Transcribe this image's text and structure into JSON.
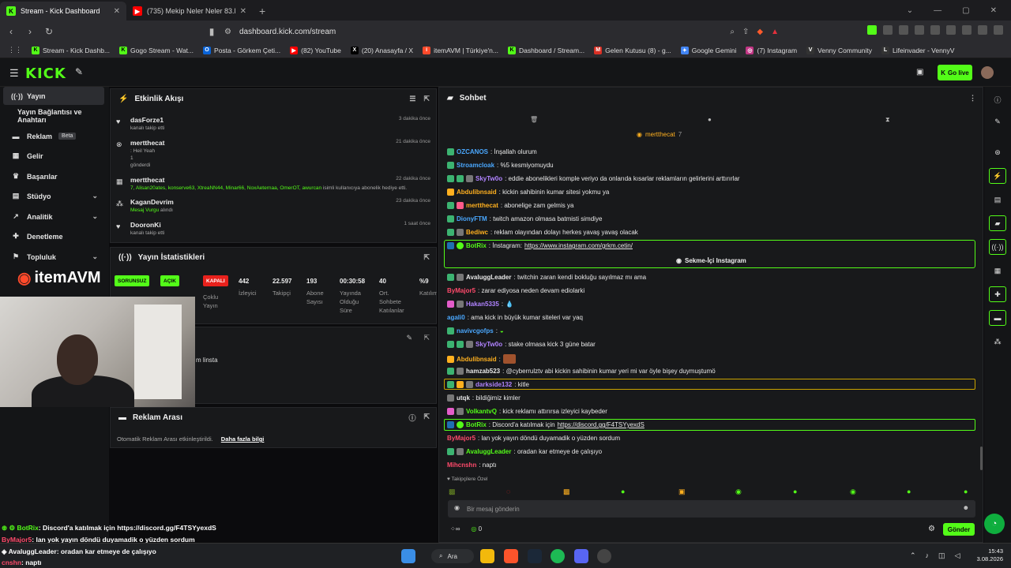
{
  "browser": {
    "tabs": [
      {
        "title": "Stream - Kick Dashboard",
        "icon": "kick-icon",
        "color": "#53fc18",
        "active": true
      },
      {
        "title": "(735) Mekip Neler Neler 83.Bölüm Ir...",
        "icon": "youtube-icon",
        "color": "#ff0000",
        "active": false
      }
    ],
    "url": "dashboard.kick.com/stream",
    "bookmarks": [
      {
        "label": "Stream - Kick Dashb...",
        "icon": "kick-icon",
        "color": "#53fc18"
      },
      {
        "label": "Gogo Stream - Wat...",
        "icon": "kick-icon",
        "color": "#53fc18"
      },
      {
        "label": "Posta - Görkem Çeti...",
        "icon": "outlook-icon",
        "color": "#0a64d8"
      },
      {
        "label": "(82) YouTube",
        "icon": "youtube-icon",
        "color": "#ff0000"
      },
      {
        "label": "(20) Anasayfa / X",
        "icon": "x-icon",
        "color": "#000000"
      },
      {
        "label": "itemAVM | Türkiye'n...",
        "icon": "itemavm-icon",
        "color": "#ff4a2b"
      },
      {
        "label": "Dashboard / Stream...",
        "icon": "kick-icon",
        "color": "#53fc18"
      },
      {
        "label": "Gelen Kutusu (8) - g...",
        "icon": "gmail-icon",
        "color": "#d93025"
      },
      {
        "label": "Google Gemini",
        "icon": "gemini-icon",
        "color": "#4285f4"
      },
      {
        "label": "(7) Instagram",
        "icon": "instagram-icon",
        "color": "#c13584"
      },
      {
        "label": "Venny Community",
        "icon": "venny-icon",
        "color": "#ffffff"
      },
      {
        "label": "Lifeinvader - VennyV",
        "icon": "lifeinvader-icon",
        "color": "#ffffff"
      }
    ]
  },
  "header": {
    "logo": "KICK",
    "go_live": "Go live",
    "brand_color": "#53fc18"
  },
  "sidebar": {
    "items": [
      {
        "label": "Yayın",
        "icon": "broadcast-icon",
        "active": true
      },
      {
        "label": "Yayın Bağlantısı ve Anahtarı"
      },
      {
        "label": "Reklam",
        "badge": "Beta",
        "icon": "ad-icon"
      },
      {
        "label": "Gelir",
        "icon": "money-icon"
      },
      {
        "label": "Başarılar",
        "icon": "trophy-icon"
      },
      {
        "label": "Stüdyo",
        "icon": "studio-icon",
        "chevron": true
      },
      {
        "label": "Analitik",
        "icon": "analytics-icon",
        "chevron": true
      },
      {
        "label": "Denetleme",
        "icon": "wrench-icon"
      },
      {
        "label": "Topluluk",
        "icon": "community-icon",
        "chevron": true
      }
    ]
  },
  "activity": {
    "title": "Etkinlik Akışı",
    "events": [
      {
        "name": "dasForze1",
        "sub": "kanalı takip etti",
        "time": "3 dakika önce"
      },
      {
        "name": "mertthecat",
        "line2": ": Heil Yeah",
        "line3": "1",
        "sub": "gönderdi",
        "time": "21 dakika önce"
      },
      {
        "name": "mertthecat",
        "gifted": "7, Alisan20ates, konserve63, XtreaNN44, Minar66, NoxAeternaa, OmerOT, awurcan",
        "sub": " isimli kullanıcıya abonelik hediye etti.",
        "time": "22 dakika önce"
      },
      {
        "name": "KaganDevrim",
        "highlight": "Mesaj Vurgu",
        "sub": " alındı",
        "time": "23 dakika önce"
      },
      {
        "name": "DooronKi",
        "sub": "kanalı takip etti",
        "time": "1 saat önce"
      }
    ]
  },
  "stats": {
    "title": "Yayın İstatistikleri",
    "pills": [
      {
        "text": "SORUNSUZ",
        "bg": "#53fc18",
        "fg": "#0b0b0d"
      },
      {
        "text": "AÇIK",
        "bg": "#53fc18",
        "fg": "#0b0b0d"
      },
      {
        "text": "KAPALI",
        "bg": "#e8211c",
        "fg": "#ffffff"
      }
    ],
    "pill_labels": [
      "Yayın",
      "Partnerlik",
      "Çoklu Yayın"
    ],
    "values": [
      {
        "value": "442",
        "label": "İzleyici"
      },
      {
        "value": "22.597",
        "label": "Takipçi"
      },
      {
        "value": "193",
        "label": "Abone Sayısı"
      },
      {
        "value": "00:30:58",
        "label": "Yayında Olduğu Süre"
      },
      {
        "value": "40",
        "label": "Ort. Sohbete Katılanlar"
      },
      {
        "value": "%9",
        "label": "Katılım"
      }
    ]
  },
  "third_panel": {
    "text": "m linsta"
  },
  "ad_break": {
    "title": "Reklam Arası",
    "text": "Otomatik Reklam Arası etkinleştirildi.",
    "link": "Daha fazla bilgi"
  },
  "chat": {
    "title": "Sohbet",
    "pinned_user": "mertthecat",
    "pinned_count": "7",
    "messages": [
      {
        "user": "OZCANOS",
        "color": "#4aa8ff",
        "text": ": İnşallah olurum"
      },
      {
        "user": "Stroamcloak",
        "color": "#4aa8ff",
        "text": ": %5 kesmiyomuydu"
      },
      {
        "user": "SkyTw0o",
        "color": "#b083ff",
        "text": ": eddie abonelikleri komple veriyo da onlarıda kısarlar reklamların gelirlerini arttırırlar"
      },
      {
        "user": "Abdulibnsaid",
        "color": "#ffb01f",
        "text": ": kickin sahibinin kumar sitesi yokmu ya"
      },
      {
        "user": "mertthecat",
        "color": "#ffb01f",
        "text": ": abonelige zam gelmis ya"
      },
      {
        "user": "DionyFTM",
        "color": "#4aa8ff",
        "text": ": twitch amazon olmasa batmisti simdiye"
      },
      {
        "user": "Bediwc",
        "color": "#ffb01f",
        "text": ": reklam olayından dolayı herkes yavaş yavaş olacak"
      },
      {
        "user": "BotRix",
        "color": "#53fc18",
        "text": ": İnstagram: ",
        "link": "https://www.instagram.com/grkm.cetin/"
      },
      {
        "user": "AvaluggLeader",
        "color": "#e8e8e8",
        "text": ": twitchin zaran kendi bokluğu sayılmaz mı ama"
      },
      {
        "user": "ByMajor5",
        "color": "#ff4a6b",
        "text": ": zarar ediyosa neden devam ediolarki"
      },
      {
        "user": "Hakan5335",
        "color": "#b083ff",
        "text": ":"
      },
      {
        "user": "agali0",
        "color": "#4aa8ff",
        "text": ": ama kick in büyük kumar siteleri var yaq"
      },
      {
        "user": "navivcgofps",
        "color": "#4aa8ff",
        "text": ":"
      },
      {
        "user": "SkyTw0o",
        "color": "#b083ff",
        "text": ": stake olmasa kick 3 güne batar"
      },
      {
        "user": "Abdulibnsaid",
        "color": "#ffb01f",
        "text": ":"
      },
      {
        "user": "hamzab523",
        "color": "#e8e8e8",
        "text": ": @cyberrulztv abi kickin sahibinin kumar yeri mi var öyle bişey duymuştumö"
      },
      {
        "user": "darkside132",
        "color": "#b083ff",
        "text": ": kitle"
      },
      {
        "user": "utqk",
        "color": "#e8e8e8",
        "text": ": bildiğimiz kimler"
      },
      {
        "user": "VolkantvQ",
        "color": "#53fc18",
        "text": ": kick reklamı attırırsa izleyici kaybeder"
      },
      {
        "user": "BotRix",
        "color": "#53fc18",
        "text": ": Discord'a katılmak için ",
        "link": "https://discord.gg/F4TSYyexdS"
      },
      {
        "user": "ByMajor5",
        "color": "#ff4a6b",
        "text": ": lan yok yayın döndü duyamadik o yüzden sordum"
      },
      {
        "user": "AvaluggLeader",
        "color": "#53fc18",
        "text": ": oradan kar etmeye de çalışıyo"
      },
      {
        "user": "Mihcnshn",
        "color": "#ff4a6b",
        "text": ": naptı"
      }
    ],
    "instagram_button": "Sekme-İçi Instagram",
    "followers_only": "Takipçilere Özel",
    "input_placeholder": "Bir mesaj gönderin",
    "points": "0",
    "send_label": "Gönder"
  },
  "overlay": {
    "brand": "itemAVM",
    "chat_lines": [
      {
        "user": "BotRix",
        "color": "#53fc18",
        "text": ": Discord'a katılmak için https://discord.gg/F4TSYyexdS"
      },
      {
        "user": "ByMajor5",
        "color": "#ff4a6b",
        "text": ": lan yok yayın döndü duyamadik o yüzden sordum"
      },
      {
        "user": "AvaluggLeader",
        "color": "#ffffff",
        "text": ": oradan kar etmeye de çalışıyo"
      },
      {
        "user": "cnshn",
        "color": "#ff4a6b",
        "text": ": naptı"
      }
    ]
  },
  "taskbar": {
    "search": "Ara",
    "time": "15:43",
    "date": "3.08.2026"
  }
}
